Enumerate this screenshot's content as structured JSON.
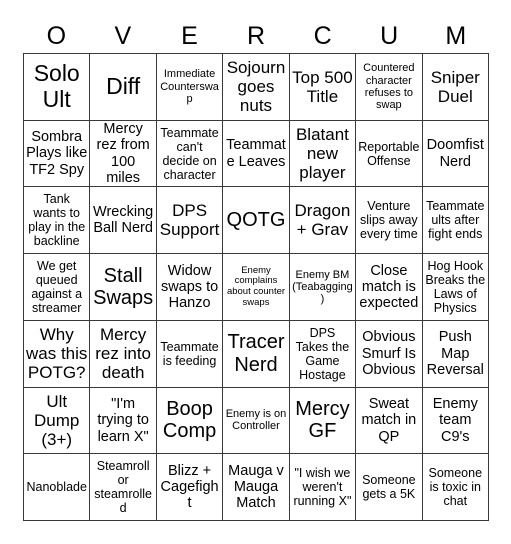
{
  "card": {
    "header_letters": [
      "O",
      "V",
      "E",
      "R",
      "C",
      "U",
      "M"
    ],
    "columns": 7,
    "rows": 7,
    "border_color": "#3a3a3a",
    "background_color": "#ffffff",
    "text_color": "#000000",
    "cells": [
      [
        {
          "text": "Solo Ult",
          "size": "xxl"
        },
        {
          "text": "Diff",
          "size": "xxl"
        },
        {
          "text": "Immediate Counterswap",
          "size": "xs"
        },
        {
          "text": "Sojourn goes nuts",
          "size": "l"
        },
        {
          "text": "Top 500 Title",
          "size": "l"
        },
        {
          "text": "Countered character refuses to swap",
          "size": "xs"
        },
        {
          "text": "Sniper Duel",
          "size": "l"
        }
      ],
      [
        {
          "text": "Sombra Plays like TF2 Spy",
          "size": "m"
        },
        {
          "text": "Mercy rez from 100 miles",
          "size": "m"
        },
        {
          "text": "Teammate can't decide on character",
          "size": "s"
        },
        {
          "text": "Teammate Leaves",
          "size": "m"
        },
        {
          "text": "Blatant new player",
          "size": "l"
        },
        {
          "text": "Reportable Offense",
          "size": "s"
        },
        {
          "text": "Doomfist Nerd",
          "size": "m"
        }
      ],
      [
        {
          "text": "Tank wants to play in the backline",
          "size": "s"
        },
        {
          "text": "Wrecking Ball Nerd",
          "size": "m"
        },
        {
          "text": "DPS Support",
          "size": "l"
        },
        {
          "text": "QOTG",
          "size": "xl"
        },
        {
          "text": "Dragon + Grav",
          "size": "l"
        },
        {
          "text": "Venture slips away every time",
          "size": "s"
        },
        {
          "text": "Teammate ults after fight ends",
          "size": "s"
        }
      ],
      [
        {
          "text": "We get queued against a streamer",
          "size": "s"
        },
        {
          "text": "Stall Swaps",
          "size": "xl"
        },
        {
          "text": "Widow swaps to Hanzo",
          "size": "m"
        },
        {
          "text": "Enemy complains about counter swaps",
          "size": "xxs"
        },
        {
          "text": "Enemy BM (Teabagging)",
          "size": "xs"
        },
        {
          "text": "Close match is expected",
          "size": "m"
        },
        {
          "text": "Hog Hook Breaks the Laws of Physics",
          "size": "s"
        }
      ],
      [
        {
          "text": "Why was this POTG?",
          "size": "l"
        },
        {
          "text": "Mercy rez into death",
          "size": "l"
        },
        {
          "text": "Teammate is feeding",
          "size": "s"
        },
        {
          "text": "Tracer Nerd",
          "size": "xl"
        },
        {
          "text": "DPS Takes the Game Hostage",
          "size": "s"
        },
        {
          "text": "Obvious Smurf Is Obvious",
          "size": "m"
        },
        {
          "text": "Push Map Reversal",
          "size": "m"
        }
      ],
      [
        {
          "text": "Ult Dump (3+)",
          "size": "l"
        },
        {
          "text": "\"I'm trying to learn X\"",
          "size": "m"
        },
        {
          "text": "Boop Comp",
          "size": "xl"
        },
        {
          "text": "Enemy is on Controller",
          "size": "xs"
        },
        {
          "text": "Mercy GF",
          "size": "xl"
        },
        {
          "text": "Sweat match in QP",
          "size": "m"
        },
        {
          "text": "Enemy team C9's",
          "size": "m"
        }
      ],
      [
        {
          "text": "Nanoblade",
          "size": "s"
        },
        {
          "text": "Steamroll or steamrolled",
          "size": "s"
        },
        {
          "text": "Blizz + Cagefight",
          "size": "m"
        },
        {
          "text": "Mauga v Mauga Match",
          "size": "m"
        },
        {
          "text": "\"I wish we weren't running X\"",
          "size": "s"
        },
        {
          "text": "Someone gets a 5K",
          "size": "s"
        },
        {
          "text": "Someone is toxic in chat",
          "size": "s"
        }
      ]
    ]
  }
}
